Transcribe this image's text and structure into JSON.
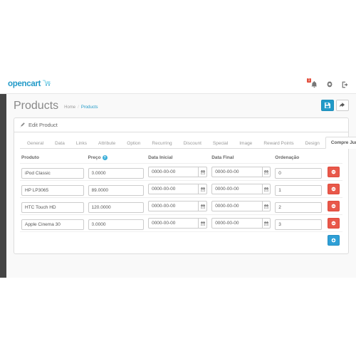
{
  "app": {
    "logo_text": "opencart",
    "logo_icon": "shopping-cart-icon"
  },
  "topbar": {
    "notification_badge": "1",
    "icons": [
      {
        "name": "bell-icon",
        "label": "Notifications"
      },
      {
        "name": "gear-icon",
        "label": "Settings"
      },
      {
        "name": "logout-icon",
        "label": "Logout"
      }
    ]
  },
  "page": {
    "title": "Products",
    "breadcrumb": {
      "home": "Home",
      "separator": "/",
      "current": "Products"
    },
    "save_label": "Save",
    "back_label": "Back"
  },
  "panel": {
    "heading": "Edit Product",
    "heading_icon": "pencil-icon"
  },
  "tabs": [
    {
      "label": "General",
      "active": false
    },
    {
      "label": "Data",
      "active": false
    },
    {
      "label": "Links",
      "active": false
    },
    {
      "label": "Attribute",
      "active": false
    },
    {
      "label": "Option",
      "active": false
    },
    {
      "label": "Recurring",
      "active": false
    },
    {
      "label": "Discount",
      "active": false
    },
    {
      "label": "Special",
      "active": false
    },
    {
      "label": "Image",
      "active": false
    },
    {
      "label": "Reward Points",
      "active": false
    },
    {
      "label": "Design",
      "active": false
    },
    {
      "label": "Compre Junto",
      "active": true
    }
  ],
  "table": {
    "columns": [
      {
        "label": "Produto",
        "info": false
      },
      {
        "label": "Preço",
        "info": true,
        "info_glyph": "?"
      },
      {
        "label": "Data Inicial",
        "info": false
      },
      {
        "label": "Data Final",
        "info": false
      },
      {
        "label": "Ordenação",
        "info": false
      }
    ],
    "rows": [
      {
        "produto": "iPod Classic",
        "preco": "0.0000",
        "data_inicial": "0000-00-00",
        "data_final": "0000-00-00",
        "ordenacao": "0",
        "remove_label": "Remove"
      },
      {
        "produto": "HP LP3065",
        "preco": "89.0000",
        "data_inicial": "0000-00-00",
        "data_final": "0000-00-00",
        "ordenacao": "1",
        "remove_label": "Remove"
      },
      {
        "produto": "HTC Touch HD",
        "preco": "120.0000",
        "data_inicial": "0000-00-00",
        "data_final": "0000-00-00",
        "ordenacao": "2",
        "remove_label": "Remove"
      },
      {
        "produto": "Apple Cinema 30",
        "preco": "0.0000",
        "data_inicial": "0000-00-00",
        "data_final": "0000-00-00",
        "ordenacao": "3",
        "remove_label": "Remove"
      }
    ],
    "add_label": "Add"
  },
  "colors": {
    "brand": "#229ac8",
    "danger": "#e8584a",
    "add": "#2e9fd6",
    "sidebar": "#3d3d3d",
    "badge": "#e3503e"
  }
}
